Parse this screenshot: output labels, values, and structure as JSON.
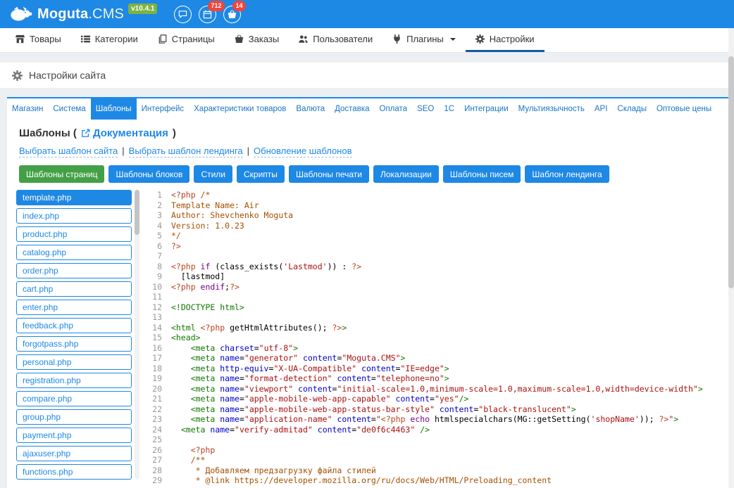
{
  "colors": {
    "primary": "#1e88e5",
    "active_green": "#43a047",
    "badge_red": "#f2453d",
    "version_green": "#7cb342"
  },
  "header": {
    "brand": "Moguta",
    "brand_suffix": ".CMS",
    "version": "v10.4.1",
    "calendar_badge": "712",
    "cart_badge": "14"
  },
  "nav": {
    "items": [
      {
        "id": "products",
        "label": "Товары",
        "icon": "shop-icon"
      },
      {
        "id": "categories",
        "label": "Категории",
        "icon": "categories-icon"
      },
      {
        "id": "pages",
        "label": "Страницы",
        "icon": "pages-icon"
      },
      {
        "id": "orders",
        "label": "Заказы",
        "icon": "orders-icon"
      },
      {
        "id": "users",
        "label": "Пользователи",
        "icon": "users-icon"
      },
      {
        "id": "plugins",
        "label": "Плагины",
        "icon": "plugins-icon",
        "caret": true
      },
      {
        "id": "settings",
        "label": "Настройки",
        "icon": "settings-icon",
        "active": true
      }
    ]
  },
  "page": {
    "title": "Настройки сайта"
  },
  "tabs": {
    "active_index": 2,
    "items": [
      {
        "id": "store",
        "label": "Магазин"
      },
      {
        "id": "system",
        "label": "Система"
      },
      {
        "id": "templates",
        "label": "Шаблоны"
      },
      {
        "id": "interface",
        "label": "Интерфейс"
      },
      {
        "id": "product-features",
        "label": "Характеристики товаров"
      },
      {
        "id": "currency",
        "label": "Валюта"
      },
      {
        "id": "delivery",
        "label": "Доставка"
      },
      {
        "id": "payment",
        "label": "Оплата"
      },
      {
        "id": "seo",
        "label": "SEO"
      },
      {
        "id": "1c",
        "label": "1С"
      },
      {
        "id": "integrations",
        "label": "Интеграции"
      },
      {
        "id": "multilanguage",
        "label": "Мультиязычность"
      },
      {
        "id": "api",
        "label": "API"
      },
      {
        "id": "warehouses",
        "label": "Склады"
      },
      {
        "id": "wholesale-prices",
        "label": "Оптовые цены"
      }
    ]
  },
  "section": {
    "title_prefix": "Шаблоны (",
    "doc_link": "Документация",
    "title_suffix": ")",
    "separator": "|",
    "links": [
      {
        "id": "choose-site-template",
        "label": "Выбрать шаблон сайта"
      },
      {
        "id": "choose-landing-template",
        "label": "Выбрать шаблон лендинга"
      },
      {
        "id": "update-templates",
        "label": "Обновление шаблонов"
      }
    ]
  },
  "template_buttons": {
    "active_index": 0,
    "items": [
      {
        "id": "page-templates",
        "label": "Шаблоны страниц"
      },
      {
        "id": "block-templates",
        "label": "Шаблоны блоков"
      },
      {
        "id": "styles",
        "label": "Стили"
      },
      {
        "id": "scripts",
        "label": "Скрипты"
      },
      {
        "id": "print-templates",
        "label": "Шаблоны печати"
      },
      {
        "id": "localizations",
        "label": "Локализации"
      },
      {
        "id": "email-templates",
        "label": "Шаблоны писем"
      },
      {
        "id": "landing-template",
        "label": "Шаблон лендинга"
      }
    ]
  },
  "files": {
    "active_index": 0,
    "items": [
      "template.php",
      "index.php",
      "product.php",
      "catalog.php",
      "order.php",
      "cart.php",
      "enter.php",
      "feedback.php",
      "forgotpass.php",
      "personal.php",
      "registration.php",
      "compare.php",
      "group.php",
      "payment.php",
      "ajaxuser.php",
      "functions.php"
    ]
  },
  "editor": {
    "lines": [
      [
        [
          "php",
          "<?php "
        ],
        [
          "com",
          "/*"
        ]
      ],
      [
        [
          "com",
          "Template Name: Air"
        ]
      ],
      [
        [
          "com",
          "Author: Shevchenko Moguta"
        ]
      ],
      [
        [
          "com",
          "Version: 1.0.23"
        ]
      ],
      [
        [
          "com",
          "*/"
        ]
      ],
      [
        [
          "php",
          "?>"
        ]
      ],
      [],
      [
        [
          "php",
          "<?php "
        ],
        [
          "kw",
          "if"
        ],
        [
          "pl",
          " (class_exists("
        ],
        [
          "str",
          "'Lastmod'"
        ],
        [
          "pl",
          ")) : "
        ],
        [
          "php",
          "?>"
        ]
      ],
      [
        [
          "pl",
          "  [lastmod]"
        ]
      ],
      [
        [
          "php",
          "<?php "
        ],
        [
          "kw",
          "endif"
        ],
        [
          "pl",
          ";"
        ],
        [
          "php",
          "?>"
        ]
      ],
      [],
      [
        [
          "tag",
          "<!DOCTYPE html>"
        ]
      ],
      [],
      [
        [
          "tag",
          "<html "
        ],
        [
          "php",
          "<?php "
        ],
        [
          "pl",
          "getHtmlAttributes(); "
        ],
        [
          "php",
          "?>"
        ],
        [
          "tag",
          ">"
        ]
      ],
      [
        [
          "tag",
          "<head>"
        ]
      ],
      [
        [
          "pl",
          "    "
        ],
        [
          "tag",
          "<meta "
        ],
        [
          "attr",
          "charset"
        ],
        [
          "pl",
          "="
        ],
        [
          "str",
          "\"utf-8\""
        ],
        [
          "tag",
          ">"
        ]
      ],
      [
        [
          "pl",
          "    "
        ],
        [
          "tag",
          "<meta "
        ],
        [
          "attr",
          "name"
        ],
        [
          "pl",
          "="
        ],
        [
          "str",
          "\"generator\""
        ],
        [
          "pl",
          " "
        ],
        [
          "attr",
          "content"
        ],
        [
          "pl",
          "="
        ],
        [
          "str",
          "\"Moguta.CMS\""
        ],
        [
          "tag",
          ">"
        ]
      ],
      [
        [
          "pl",
          "    "
        ],
        [
          "tag",
          "<meta "
        ],
        [
          "attr",
          "http-equiv"
        ],
        [
          "pl",
          "="
        ],
        [
          "str",
          "\"X-UA-Compatible\""
        ],
        [
          "pl",
          " "
        ],
        [
          "attr",
          "content"
        ],
        [
          "pl",
          "="
        ],
        [
          "str",
          "\"IE=edge\""
        ],
        [
          "tag",
          ">"
        ]
      ],
      [
        [
          "pl",
          "    "
        ],
        [
          "tag",
          "<meta "
        ],
        [
          "attr",
          "name"
        ],
        [
          "pl",
          "="
        ],
        [
          "str",
          "\"format-detection\""
        ],
        [
          "pl",
          " "
        ],
        [
          "attr",
          "content"
        ],
        [
          "pl",
          "="
        ],
        [
          "str",
          "\"telephone=no\""
        ],
        [
          "tag",
          ">"
        ]
      ],
      [
        [
          "pl",
          "    "
        ],
        [
          "tag",
          "<meta "
        ],
        [
          "attr",
          "name"
        ],
        [
          "pl",
          "="
        ],
        [
          "str",
          "\"viewport\""
        ],
        [
          "pl",
          " "
        ],
        [
          "attr",
          "content"
        ],
        [
          "pl",
          "="
        ],
        [
          "str",
          "\"initial-scale=1.0,minimum-scale=1.0,maximum-scale=1.0,width=device-width\""
        ],
        [
          "tag",
          ">"
        ]
      ],
      [
        [
          "pl",
          "    "
        ],
        [
          "tag",
          "<meta "
        ],
        [
          "attr",
          "name"
        ],
        [
          "pl",
          "="
        ],
        [
          "str",
          "\"apple-mobile-web-app-capable\""
        ],
        [
          "pl",
          " "
        ],
        [
          "attr",
          "content"
        ],
        [
          "pl",
          "="
        ],
        [
          "str",
          "\"yes\""
        ],
        [
          "tag",
          "/>"
        ]
      ],
      [
        [
          "pl",
          "    "
        ],
        [
          "tag",
          "<meta "
        ],
        [
          "attr",
          "name"
        ],
        [
          "pl",
          "="
        ],
        [
          "str",
          "\"apple-mobile-web-app-status-bar-style\""
        ],
        [
          "pl",
          " "
        ],
        [
          "attr",
          "content"
        ],
        [
          "pl",
          "="
        ],
        [
          "str",
          "\"black-translucent\""
        ],
        [
          "tag",
          ">"
        ]
      ],
      [
        [
          "pl",
          "    "
        ],
        [
          "tag",
          "<meta "
        ],
        [
          "attr",
          "name"
        ],
        [
          "pl",
          "="
        ],
        [
          "str",
          "\"application-name\""
        ],
        [
          "pl",
          " "
        ],
        [
          "attr",
          "content"
        ],
        [
          "pl",
          "="
        ],
        [
          "str",
          "\""
        ],
        [
          "php",
          "<?php "
        ],
        [
          "kw",
          "echo"
        ],
        [
          "pl",
          " htmlspecialchars(MG::getSetting("
        ],
        [
          "str",
          "'shopName'"
        ],
        [
          "pl",
          ")); "
        ],
        [
          "php",
          "?>"
        ],
        [
          "str",
          "\""
        ],
        [
          "tag",
          ">"
        ]
      ],
      [
        [
          "pl",
          "  "
        ],
        [
          "tag",
          "<meta "
        ],
        [
          "attr",
          "name"
        ],
        [
          "pl",
          "="
        ],
        [
          "str",
          "\"verify-admitad\""
        ],
        [
          "pl",
          " "
        ],
        [
          "attr",
          "content"
        ],
        [
          "pl",
          "="
        ],
        [
          "str",
          "\"de0f6c4463\""
        ],
        [
          "pl",
          " "
        ],
        [
          "tag",
          "/>"
        ]
      ],
      [],
      [
        [
          "pl",
          "    "
        ],
        [
          "php",
          "<?php"
        ]
      ],
      [
        [
          "pl",
          "    "
        ],
        [
          "com",
          "/**"
        ]
      ],
      [
        [
          "com",
          "     * Добавляем предзагрузку файла стилей"
        ]
      ],
      [
        [
          "com",
          "     * @link https://developer.mozilla.org/ru/docs/Web/HTML/Preloading_content"
        ]
      ]
    ]
  }
}
